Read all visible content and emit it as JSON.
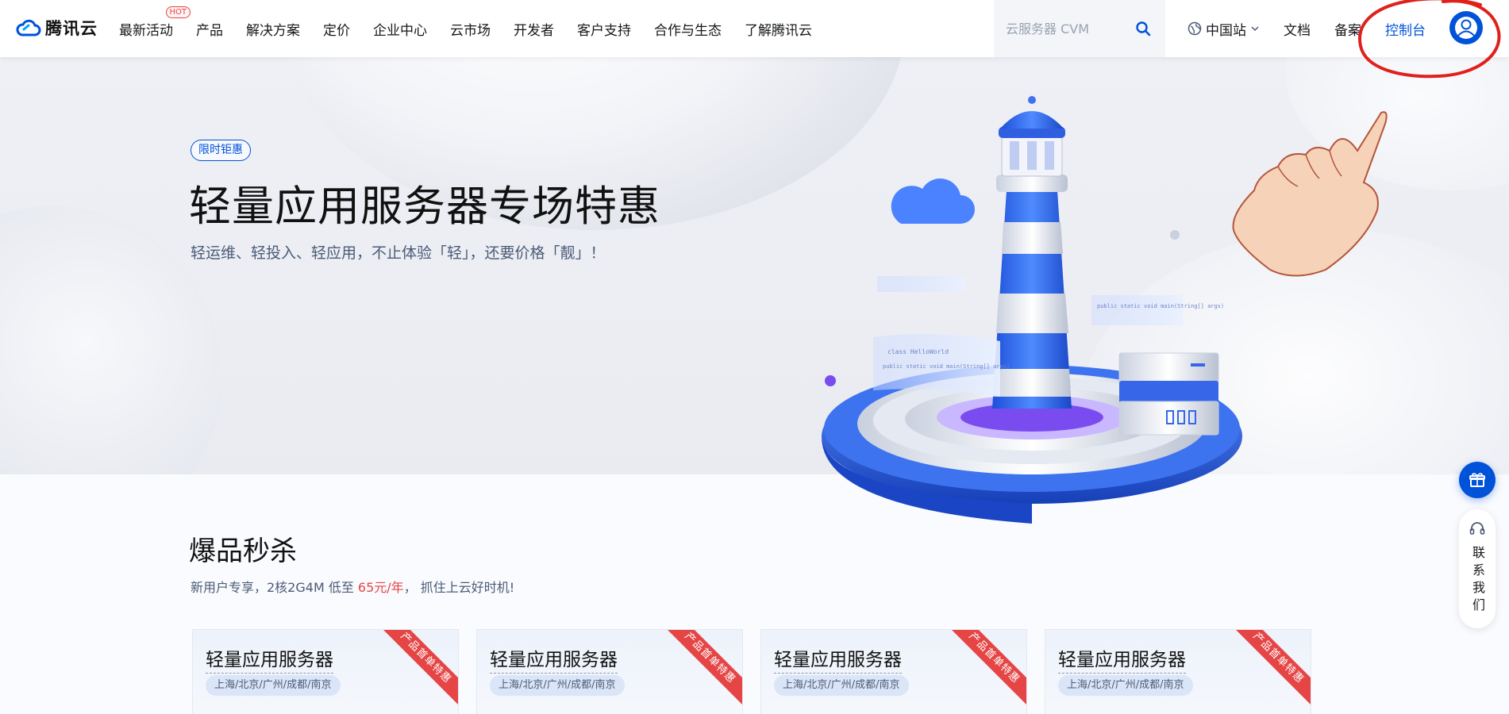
{
  "header": {
    "logo_text": "腾讯云",
    "nav": [
      "最新活动",
      "产品",
      "解决方案",
      "定价",
      "企业中心",
      "云市场",
      "开发者",
      "客户支持",
      "合作与生态",
      "了解腾讯云"
    ],
    "hot_badge": "HOT",
    "search_placeholder": "云服务器 CVM",
    "region": "中国站",
    "docs": "文档",
    "beian": "备案",
    "console": "控制台"
  },
  "hero": {
    "badge": "限时钜惠",
    "title": "轻量应用服务器专场特惠",
    "subtitle": "轻运维、轻投入、轻应用，不止体验「轻」，还要价格「靓」！",
    "code_text_1": "public static void main(String[] args)",
    "code_text_2": "class HelloWorld"
  },
  "section": {
    "title": "爆品秒杀",
    "subtitle_prefix": "新用户专享，2核2G4M 低至 ",
    "subtitle_price": "65元/年",
    "subtitle_suffix": "， 抓住上云好时机!"
  },
  "cards": [
    {
      "title": "轻量应用服务器",
      "regions": "上海/北京/广州/成都/南京",
      "ribbon": "产品首单特惠"
    },
    {
      "title": "轻量应用服务器",
      "regions": "上海/北京/广州/成都/南京",
      "ribbon": "产品首单特惠"
    },
    {
      "title": "轻量应用服务器",
      "regions": "上海/北京/广州/成都/南京",
      "ribbon": "产品首单特惠"
    },
    {
      "title": "轻量应用服务器",
      "regions": "上海/北京/广州/成都/南京",
      "ribbon": "产品首单特惠"
    }
  ],
  "widget": {
    "contact": "联系我们"
  },
  "colors": {
    "brand": "#0052d9",
    "accent_red": "#e54545",
    "annotation_red": "#e0201c"
  },
  "icons": {
    "logo": "cloud-logo-icon",
    "search": "search-icon",
    "region": "globe-icon",
    "chevron": "chevron-down-icon",
    "avatar": "user-avatar-icon",
    "gift": "gift-icon",
    "headset": "headset-icon"
  }
}
